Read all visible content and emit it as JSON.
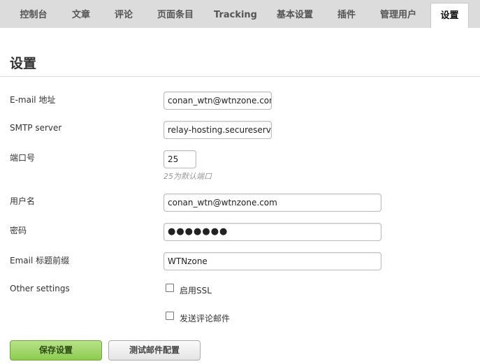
{
  "tabs": [
    {
      "label": "控制台"
    },
    {
      "label": "文章"
    },
    {
      "label": "评论"
    },
    {
      "label": "页面条目"
    },
    {
      "label": "Tracking"
    },
    {
      "label": "基本设置"
    },
    {
      "label": "插件"
    },
    {
      "label": "管理用户"
    },
    {
      "label": "设置",
      "active": true
    }
  ],
  "page": {
    "title": "设置"
  },
  "form": {
    "email": {
      "label": "E-mail 地址",
      "value": "conan_wtn@wtnzone.com"
    },
    "smtp": {
      "label": "SMTP server",
      "value": "relay-hosting.secureserver.net"
    },
    "port": {
      "label": "端口号",
      "value": "25",
      "hint": "25为默认端口"
    },
    "username": {
      "label": "用户名",
      "value": "conan_wtn@wtnzone.com"
    },
    "password": {
      "label": "密码",
      "value": "●●●●●●●"
    },
    "prefix": {
      "label": "Email 标题前缀",
      "value": "WTNzone"
    },
    "other": {
      "label": "Other settings",
      "ssl_label": "启用SSL",
      "ssl_checked": false,
      "notify_label": "发送评论邮件",
      "notify_checked": false
    }
  },
  "buttons": {
    "save": "保存设置",
    "test": "测试邮件配置"
  }
}
